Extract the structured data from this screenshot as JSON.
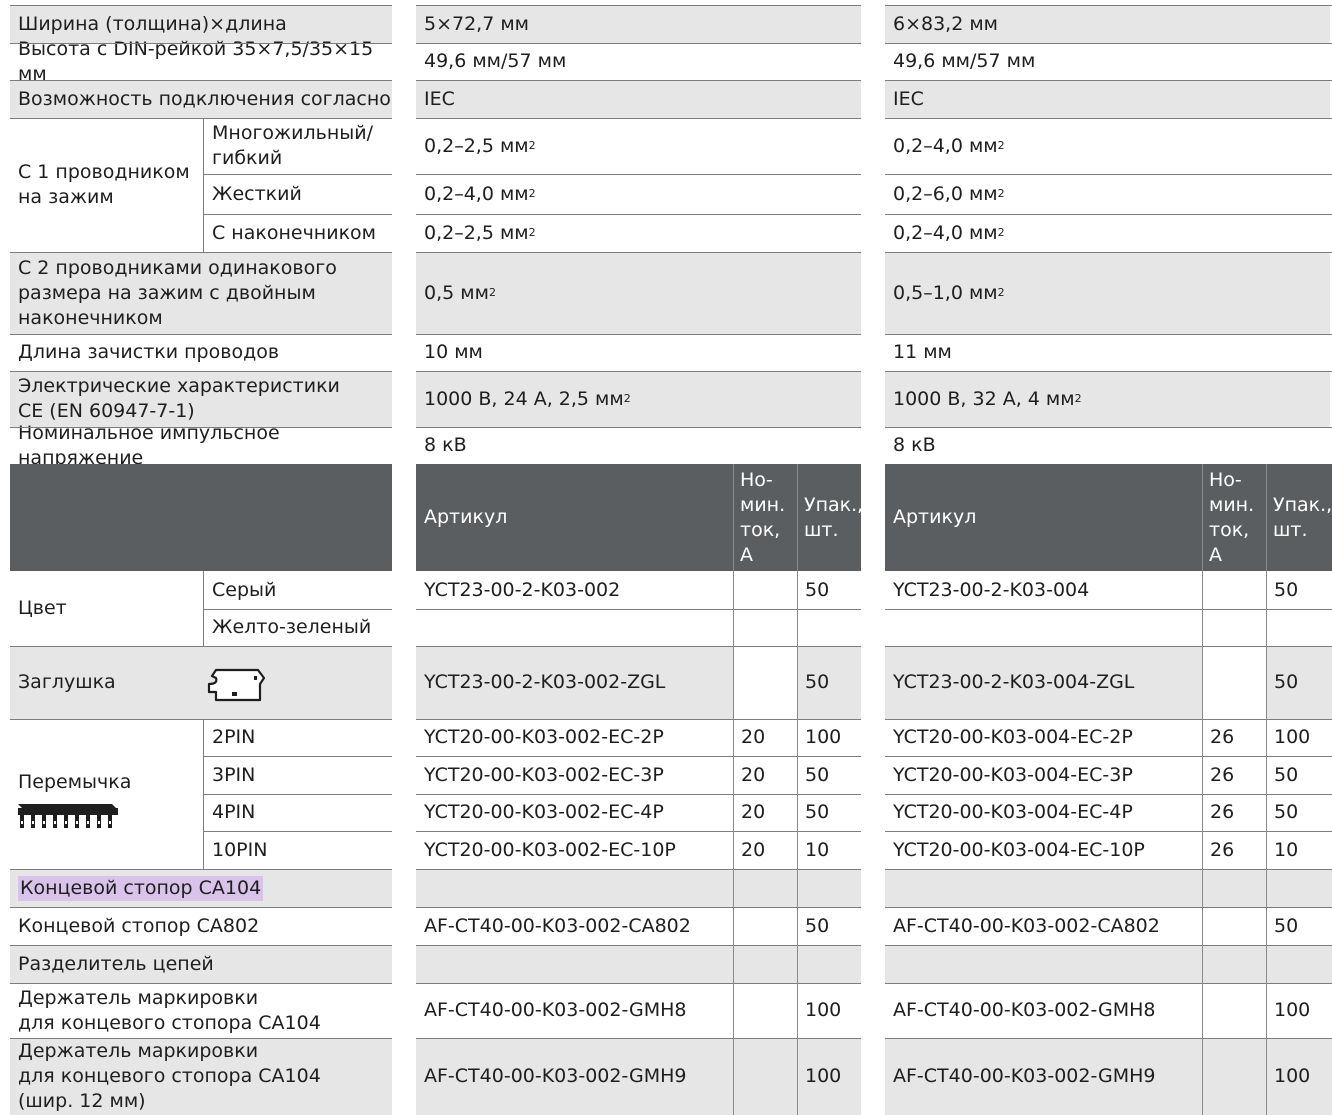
{
  "specs": {
    "width_label": "Ширина (толщина)×длина",
    "width_a": "5×72,7 мм",
    "width_b": "6×83,2 мм",
    "height_label": "Высота с DIN-рейкой 35×7,5/35×15 мм",
    "height_a": "49,6 мм/57 мм",
    "height_b": "49,6 мм/57 мм",
    "connect_label": "Возможность подключения согласно",
    "connect_a": "IEC",
    "connect_b": "IEC",
    "one_conductor_label": "С 1 проводником\nна зажим",
    "multi_label": "Многожильный/\nгибкий",
    "multi_a": "0,2–2,5 мм",
    "multi_b": "0,2–4,0 мм",
    "solid_label": "Жесткий",
    "solid_a": "0,2–4,0 мм",
    "solid_b": "0,2–6,0 мм",
    "ferrule_label": "С наконечником",
    "ferrule_a": "0,2–2,5 мм",
    "ferrule_b": "0,2–4,0 мм",
    "two_conductor_label": "С 2 проводниками одинакового\nразмера на зажим с двойным\nнаконечником",
    "two_a": "0,5 мм",
    "two_b": "0,5–1,0 мм",
    "strip_label": "Длина зачистки проводов",
    "strip_a": "10 мм",
    "strip_b": "11 мм",
    "elec_label": "Электрические характеристики\nCE (EN 60947-7-1)",
    "elec_a": "1000 В, 24 А, 2,5 мм",
    "elec_b": "1000 В, 32 А, 4 мм",
    "impulse_label": "Номинальное импульсное напряжение",
    "impulse_a": "8 кВ",
    "impulse_b": "8 кВ",
    "sup": "2"
  },
  "header": {
    "article": "Артикул",
    "current": "Но-\nмин.\nток,\nА",
    "pack": "Упак.,\nшт."
  },
  "orders": {
    "color_label": "Цвет",
    "grey_label": "Серый",
    "grey_a": "YCT23-00-2-K03-002",
    "grey_a_pack": "50",
    "grey_b": "YCT23-00-2-K03-004",
    "grey_b_pack": "50",
    "yg_label": "Желто-зеленый",
    "cap_label": "Заглушка",
    "cap_a": "YCT23-00-2-K03-002-ZGL",
    "cap_a_pack": "50",
    "cap_b": "YCT23-00-2-K03-004-ZGL",
    "cap_b_pack": "50",
    "jumper_label": "Перемычка",
    "jumpers": [
      {
        "pin": "2PIN",
        "a": "YCT20-00-K03-002-EC-2P",
        "a_cur": "20",
        "a_pack": "100",
        "b": "YCT20-00-K03-004-EC-2P",
        "b_cur": "26",
        "b_pack": "100"
      },
      {
        "pin": "3PIN",
        "a": "YCT20-00-K03-002-EC-3P",
        "a_cur": "20",
        "a_pack": "50",
        "b": "YCT20-00-K03-004-EC-3P",
        "b_cur": "26",
        "b_pack": "50"
      },
      {
        "pin": "4PIN",
        "a": "YCT20-00-K03-002-EC-4P",
        "a_cur": "20",
        "a_pack": "50",
        "b": "YCT20-00-K03-004-EC-4P",
        "b_cur": "26",
        "b_pack": "50"
      },
      {
        "pin": "10PIN",
        "a": "YCT20-00-K03-002-EC-10P",
        "a_cur": "20",
        "a_pack": "10",
        "b": "YCT20-00-K03-004-EC-10P",
        "b_cur": "26",
        "b_pack": "10"
      }
    ],
    "stop104_label": "Концевой стопор CA104",
    "stop802_label": "Концевой стопор CA802",
    "stop802_a": "AF-CT40-00-K03-002-CA802",
    "stop802_a_pack": "50",
    "stop802_b": "AF-CT40-00-K03-002-CA802",
    "stop802_b_pack": "50",
    "separator_label": "Разделитель цепей",
    "holder8_label": "Держатель маркировки\nдля концевого стопора CA104",
    "holder8_a": "AF-CT40-00-K03-002-GMH8",
    "holder8_a_pack": "100",
    "holder8_b": "AF-CT40-00-K03-002-GMH8",
    "holder8_b_pack": "100",
    "holder9_label": "Держатель маркировки\nдля концевого стопора CA104\n(шир. 12 мм)",
    "holder9_a": "AF-CT40-00-K03-002-GMH9",
    "holder9_a_pack": "100",
    "holder9_b": "AF-CT40-00-K03-002-GMH9",
    "holder9_b_pack": "100"
  }
}
